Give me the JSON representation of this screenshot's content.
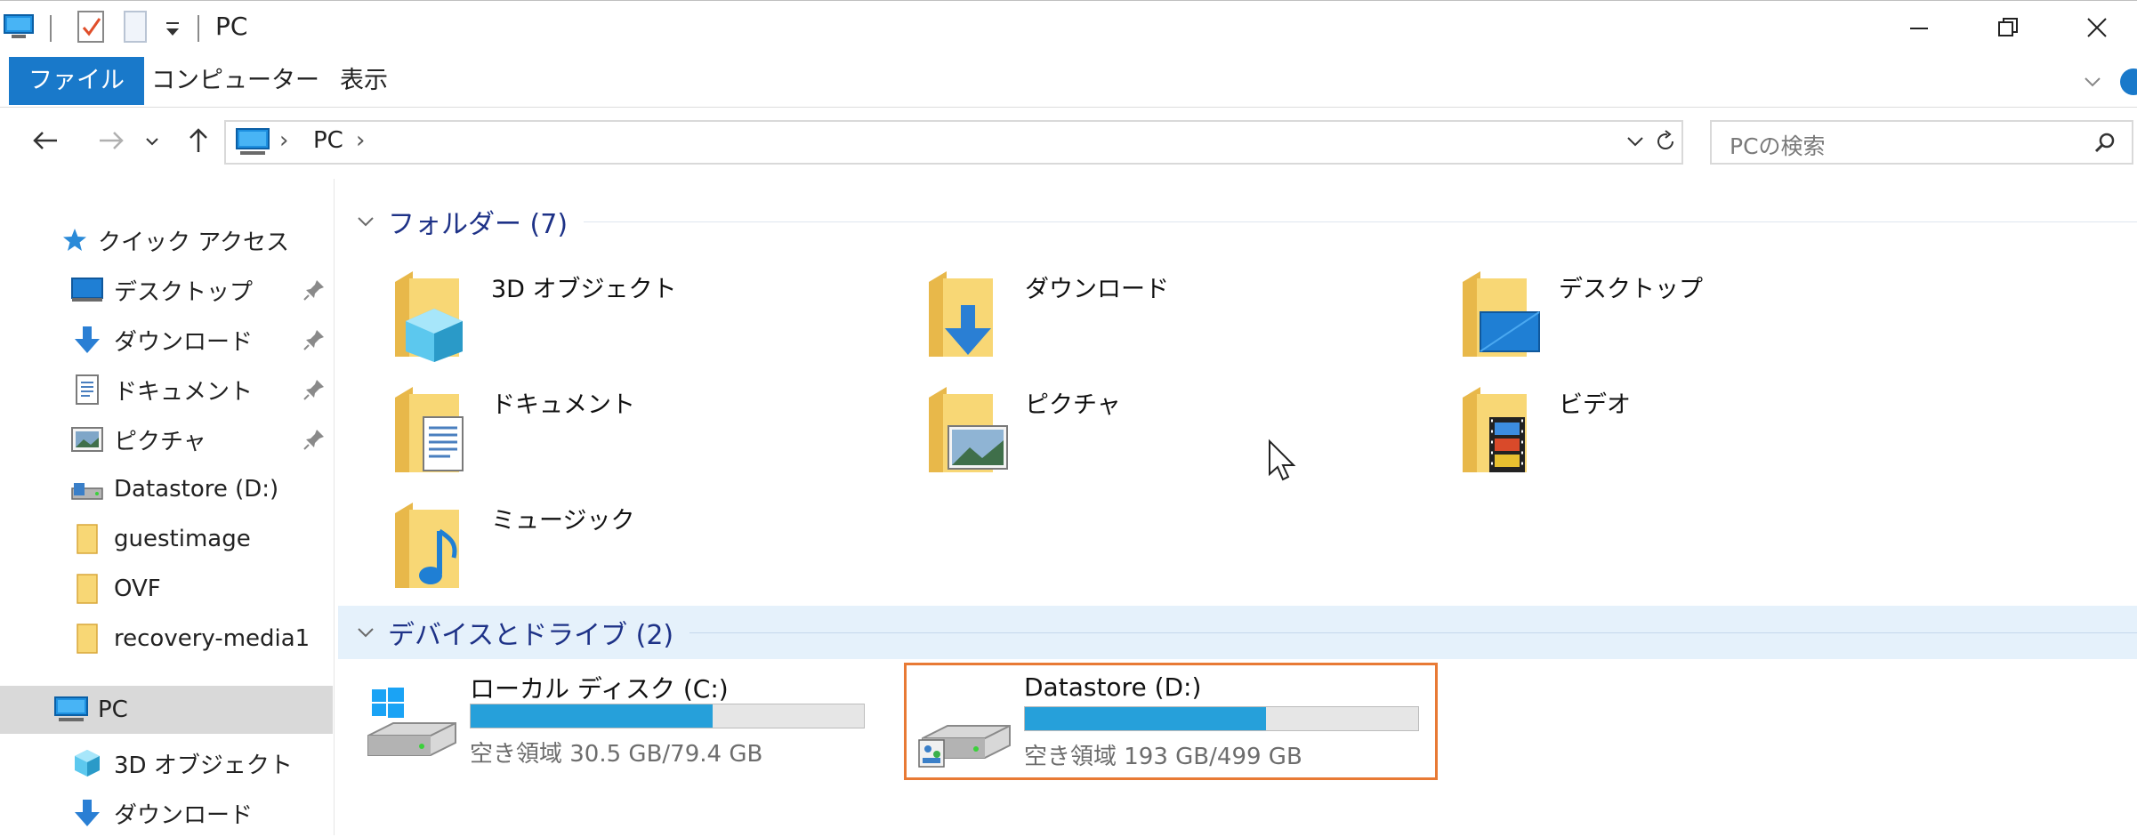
{
  "window": {
    "title": "PC",
    "controls": {
      "minimize": "minimize-icon",
      "maximize": "restore-icon",
      "close": "close-icon"
    }
  },
  "ribbon": {
    "tabs": [
      {
        "label": "ファイル",
        "active": true
      },
      {
        "label": "コンピューター",
        "active": false
      },
      {
        "label": "表示",
        "active": false
      }
    ]
  },
  "address": {
    "path": [
      "PC"
    ],
    "separator": "›",
    "search_placeholder": "PCの検索"
  },
  "nav_pane": {
    "quick_access_label": "クイック アクセス",
    "quick_access_items": [
      {
        "label": "デスクトップ",
        "icon": "desktop-icon",
        "pinned": true
      },
      {
        "label": "ダウンロード",
        "icon": "download-icon",
        "pinned": true
      },
      {
        "label": "ドキュメント",
        "icon": "document-icon",
        "pinned": true
      },
      {
        "label": "ピクチャ",
        "icon": "picture-icon",
        "pinned": true
      },
      {
        "label": "Datastore (D:)",
        "icon": "network-drive-icon",
        "pinned": false
      },
      {
        "label": "guestimage",
        "icon": "folder-icon",
        "pinned": false
      },
      {
        "label": "OVF",
        "icon": "folder-icon",
        "pinned": false
      },
      {
        "label": "recovery-media1",
        "icon": "folder-icon",
        "pinned": false
      }
    ],
    "pc_label": "PC",
    "pc_items": [
      {
        "label": "3D オブジェクト",
        "icon": "3d-objects-icon"
      },
      {
        "label": "ダウンロード",
        "icon": "download-icon"
      }
    ]
  },
  "folders_group": {
    "header": "フォルダー (7)",
    "items": [
      {
        "label": "3D オブジェクト",
        "icon": "3d-objects-folder-icon"
      },
      {
        "label": "ダウンロード",
        "icon": "download-folder-icon"
      },
      {
        "label": "デスクトップ",
        "icon": "desktop-folder-icon"
      },
      {
        "label": "ドキュメント",
        "icon": "document-folder-icon"
      },
      {
        "label": "ピクチャ",
        "icon": "picture-folder-icon"
      },
      {
        "label": "ビデオ",
        "icon": "video-folder-icon"
      },
      {
        "label": "ミュージック",
        "icon": "music-folder-icon"
      }
    ]
  },
  "drives_group": {
    "header": "デバイスとドライブ (2)",
    "items": [
      {
        "name": "ローカル ディスク (C:)",
        "free_text": "空き領域 30.5 GB/79.4 GB",
        "used_fraction": 0.616,
        "selected": false,
        "icon": "windows-drive-icon"
      },
      {
        "name": "Datastore (D:)",
        "free_text": "空き領域 193 GB/499 GB",
        "used_fraction": 0.613,
        "selected": true,
        "icon": "network-drive-icon"
      }
    ]
  },
  "colors": {
    "accent": "#1979ca",
    "group_header": "#1e3287",
    "drive_bar_fill": "#26a0da",
    "selection_border": "#e87a35",
    "folder_yellow": "#f8d775"
  }
}
